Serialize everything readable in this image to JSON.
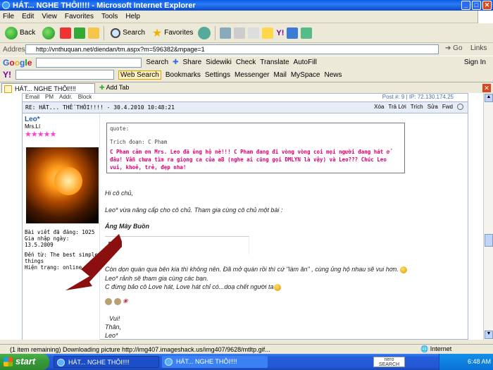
{
  "window": {
    "title": "HÁT... NGHE THÔI!!!! - Microsoft Internet Explorer"
  },
  "menu": [
    "File",
    "Edit",
    "View",
    "Favorites",
    "Tools",
    "Help"
  ],
  "toolbar": {
    "back": "Back",
    "search": "Search",
    "favorites": "Favorites"
  },
  "address": {
    "label": "Address",
    "url": "http://vnthuquan.net/diendan/tm.aspx?m=596382&mpage=1",
    "go": "Go",
    "links": "Links"
  },
  "google_bar": {
    "search": "Search",
    "sidewiki": "Sidewiki",
    "check": "Check",
    "translate": "Translate",
    "autofill": "AutoFill",
    "sign_in": "Sign In",
    "share": "Share"
  },
  "yahoo_bar": {
    "web_search": "Web Search",
    "bookmarks": "Bookmarks",
    "settings": "Settings",
    "messenger": "Messenger",
    "mail": "Mail",
    "myspace": "MySpace",
    "news": "News"
  },
  "tabs": {
    "active": "HÁT... NGHE THÔI!!!!",
    "add": "Add Tab"
  },
  "post": {
    "top_links": [
      "Email",
      "PM",
      "Addr.",
      "Block"
    ],
    "post_no": "Post #: 9 | IP: 72.130.174.25",
    "subject": "RE: HÁT... THẾ THÔI!!!! - 30.4.2010 10:48:21",
    "actions": [
      "Xóa",
      "Trả Lời",
      "Trích",
      "Sửa",
      "Fwd"
    ],
    "user": {
      "name": "Leo*",
      "rank": "Mrs.Lí",
      "stars": "★★★★★",
      "posts": "Bài viết đã đăng: 1025",
      "joined": "Gia nhập ngày: 13.5.2009",
      "from": "Đến từ: The best simple things",
      "status": "Hiện trạng: online"
    },
    "quote": {
      "label": "quote:",
      "source": "Trích đoạn: C Pham",
      "text": "C Pham cảm ơn Mrs. Leo đã ủng hộ nè!!! C Pham đang đi vòng vòng coi mọi người đang hát ở đâu! Vẫn chưa tìm ra giọng ca của aB (nghe ai cũng gọi DMLYN là vậy) và Leo??? Chúc Leo vui, khoẻ, trẻ, đẹp nha!"
    },
    "body": {
      "line1": "Hi cô chủ,",
      "line2": "Leo* vừa nâng cấp cho cô chủ. Tham gia cùng cô chủ một bài :",
      "song": "Áng Mây Buồn",
      "line3": "Còn dọn quán qua bên kia thì không nên. Đã mở quán rồi thì cứ \"làm ăn\" , cùng ủng hộ nhau sẽ vui hơn.",
      "line4": "Leo* rảnh sẽ tham gia cùng các bạn.",
      "line5": "C đừng bảo cô Love hát, Love hát chỉ có...doạ chết người ta",
      "sig1": "Vui!",
      "sig2": "Thân,",
      "sig3": "Leo*"
    }
  },
  "status": {
    "text": "(1 item remaining) Downloading picture http://img407.imageshack.us/img407/9628/mtltp.gif...",
    "zone": "Internet"
  },
  "taskbar": {
    "start": "start",
    "task1": "HÁT... NGHE THÔI!!!!",
    "task2": "HÁT... NGHE THÔI!!!!",
    "clock": "6:48 AM",
    "nero": "nero SEARCH"
  }
}
